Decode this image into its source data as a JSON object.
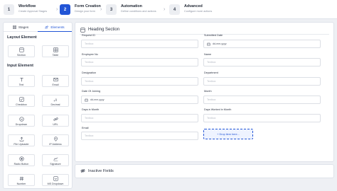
{
  "stepper": {
    "steps": [
      {
        "num": "1",
        "title": "Workflow",
        "subtitle": "Create Approval Stages"
      },
      {
        "num": "2",
        "title": "Form Creation",
        "subtitle": "Design your form"
      },
      {
        "num": "3",
        "title": "Automation",
        "subtitle": "Define conditions and actions"
      },
      {
        "num": "4",
        "title": "Advanced",
        "subtitle": "Configure more actions"
      }
    ],
    "active_step": 2
  },
  "panel": {
    "tabs": [
      {
        "label": "Stages",
        "icon": "grid-icon"
      },
      {
        "label": "Elements",
        "icon": "shapes-icon"
      }
    ],
    "active_tab": "Elements",
    "layout_heading": "Layout Element",
    "layout_items": [
      {
        "label": "Section",
        "icon": "section-icon"
      },
      {
        "label": "Table",
        "icon": "table-icon"
      }
    ],
    "input_heading": "Input Element",
    "input_items": [
      {
        "label": "Text",
        "icon": "text-icon"
      },
      {
        "label": "Email",
        "icon": "mail-icon"
      },
      {
        "label": "Checkbox",
        "icon": "checkbox-icon"
      },
      {
        "label": "Decimal",
        "icon": "decimal-icon"
      },
      {
        "label": "Dropdown",
        "icon": "dropdown-icon"
      },
      {
        "label": "URL",
        "icon": "link-icon"
      },
      {
        "label": "File Uploader",
        "icon": "upload-icon"
      },
      {
        "label": "IP Address",
        "icon": "ip-icon"
      },
      {
        "label": "Radio Button",
        "icon": "radio-icon"
      },
      {
        "label": "Signature",
        "icon": "signature-icon"
      },
      {
        "label": "Number",
        "icon": "hash-icon"
      },
      {
        "label": "MS Dropdown",
        "icon": "multi-dropdown-icon"
      }
    ]
  },
  "main": {
    "heading": "Heading Section",
    "fields": [
      {
        "label": "Request ID",
        "placeholder": "Textbox",
        "kind": "text"
      },
      {
        "label": "Submitted Date",
        "placeholder": "dd-mm-yyyy",
        "kind": "date"
      },
      {
        "label": "Employee No",
        "placeholder": "Textbox",
        "kind": "text"
      },
      {
        "label": "Name",
        "placeholder": "Textbox",
        "kind": "text"
      },
      {
        "label": "Designation",
        "placeholder": "Textbox",
        "kind": "text"
      },
      {
        "label": "Department",
        "placeholder": "Textbox",
        "kind": "text"
      },
      {
        "label": "Date Of Joining",
        "placeholder": "dd-mm-yyyy",
        "kind": "date"
      },
      {
        "label": "Month",
        "placeholder": "Textbox",
        "kind": "text"
      },
      {
        "label": "Days in Month",
        "placeholder": "Textbox",
        "kind": "text"
      },
      {
        "label": "Days Worked in Month",
        "placeholder": "Textbox",
        "kind": "text"
      },
      {
        "label": "Email",
        "placeholder": "Textbox",
        "kind": "text"
      }
    ],
    "dropzone": "+ Drop item here..."
  },
  "inactive": {
    "label": "Inactive Fields"
  },
  "colors": {
    "accent": "#2255d6",
    "background": "#eef0f4"
  }
}
